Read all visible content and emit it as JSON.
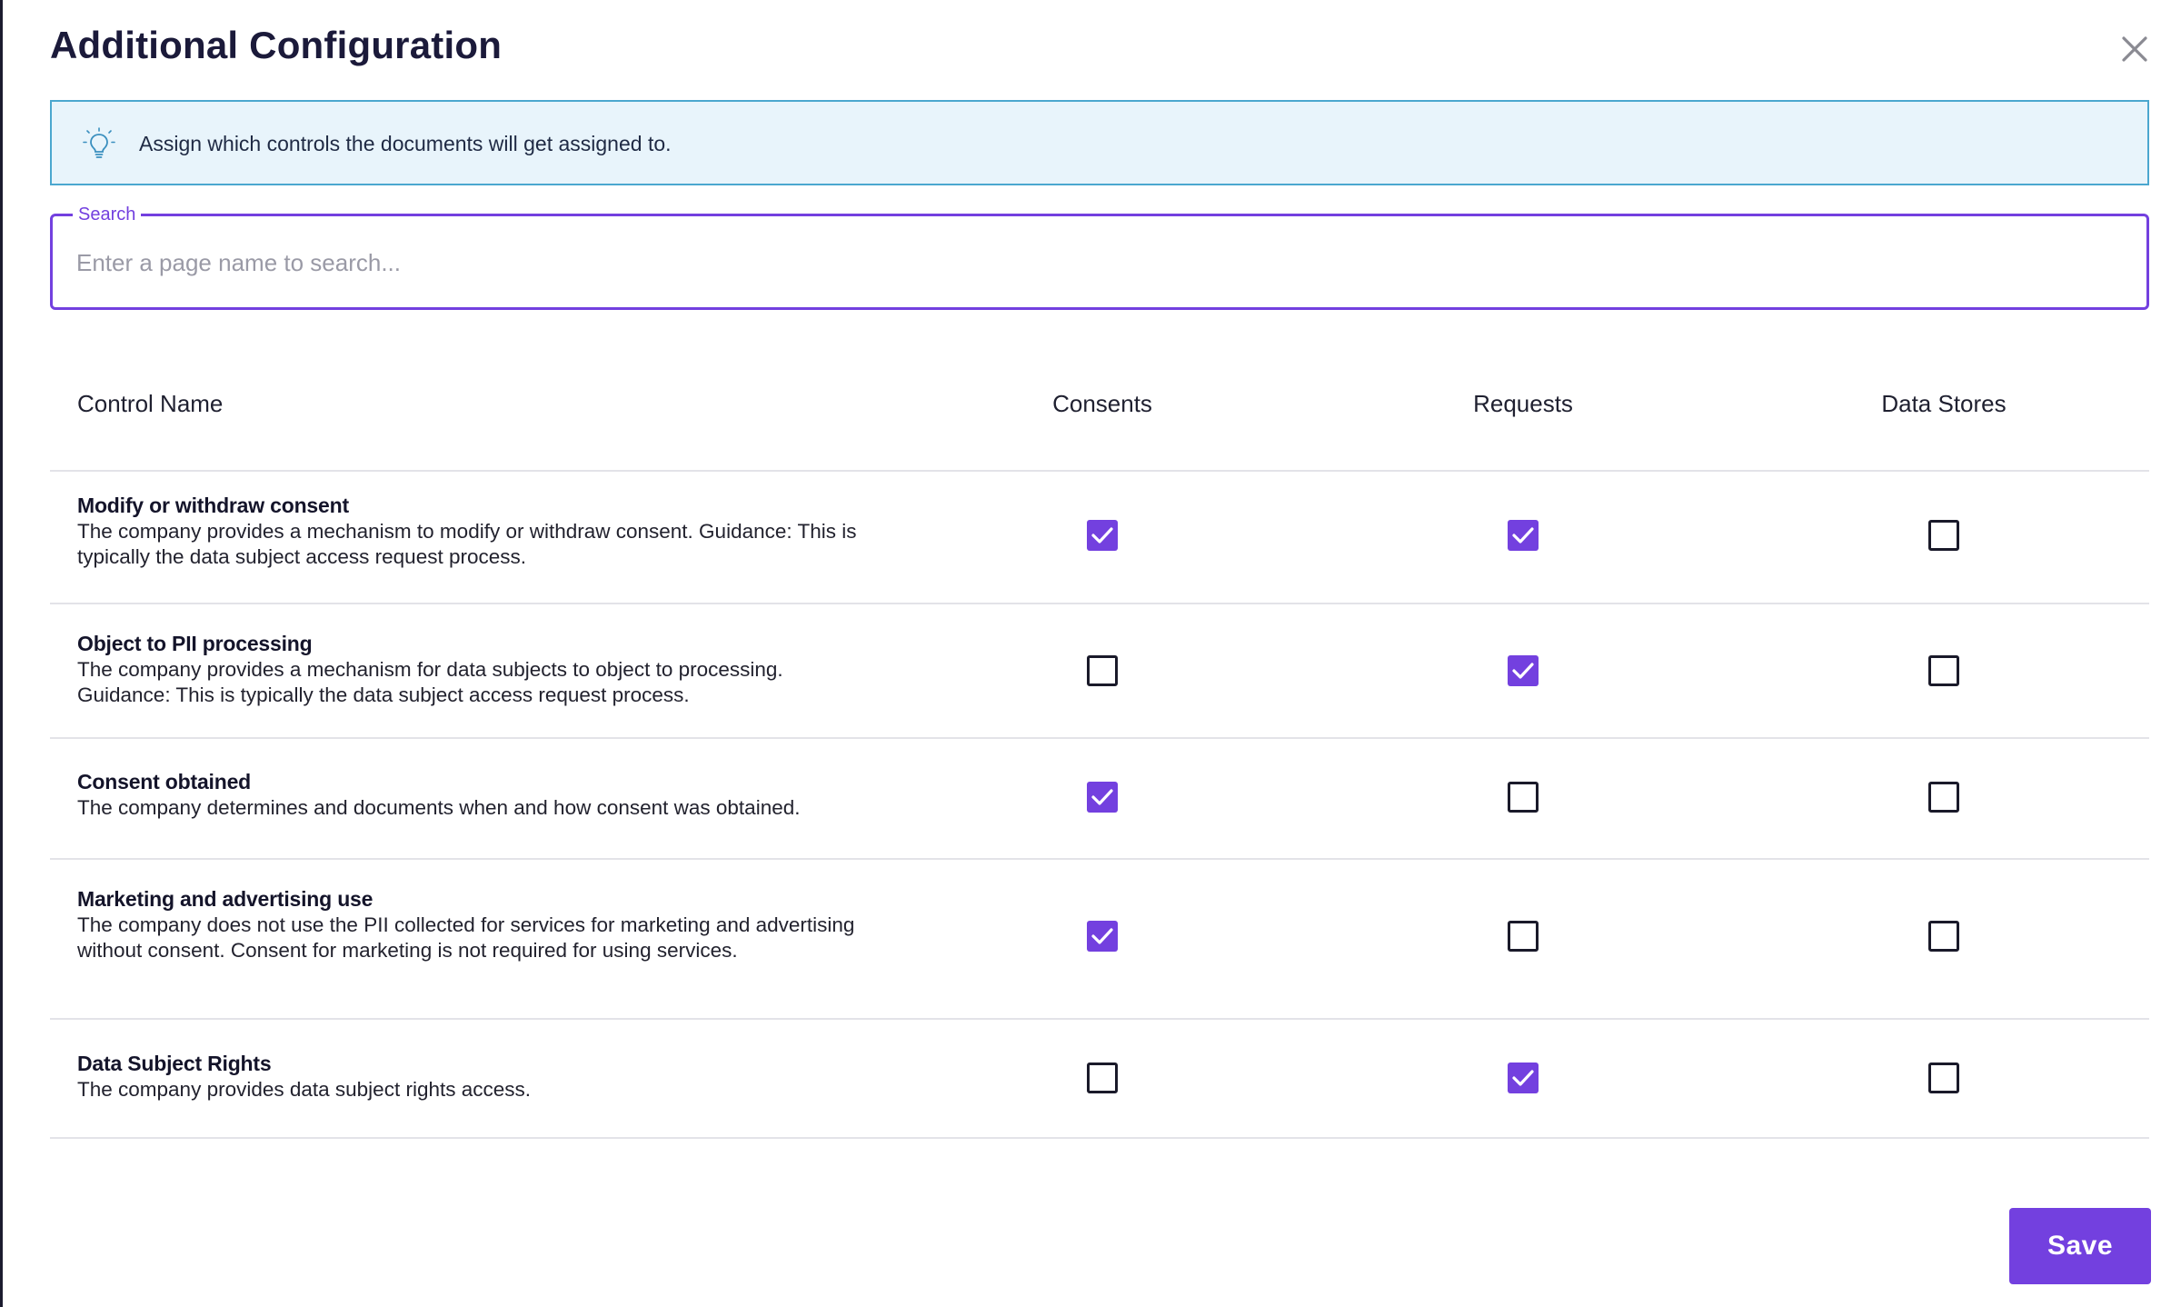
{
  "dialog": {
    "title": "Additional Configuration",
    "close_icon": "close-icon"
  },
  "banner": {
    "icon": "lightbulb-icon",
    "text": "Assign which controls the documents will get assigned to."
  },
  "search": {
    "label": "Search",
    "placeholder": "Enter a page name to search...",
    "value": ""
  },
  "table": {
    "columns": [
      "Control Name",
      "Consents",
      "Requests",
      "Data Stores"
    ],
    "rows": [
      {
        "title": "Modify or withdraw consent",
        "description": "The company provides a mechanism to modify or withdraw consent. Guidance: This is typically the data subject access request process.",
        "consents": true,
        "requests": true,
        "data_stores": false
      },
      {
        "title": "Object to PII processing",
        "description": "The company provides a mechanism for data subjects to object to processing. Guidance: This is typically the data subject access request process.",
        "consents": false,
        "requests": true,
        "data_stores": false
      },
      {
        "title": "Consent obtained",
        "description": "The company determines and documents when and how consent was obtained.",
        "consents": true,
        "requests": false,
        "data_stores": false
      },
      {
        "title": "Marketing and advertising use",
        "description": "The company does not use the PII collected for services for marketing and advertising without consent. Consent for marketing is not required for using services.",
        "consents": true,
        "requests": false,
        "data_stores": false
      },
      {
        "title": "Data Subject Rights",
        "description": "The company provides data subject rights access.",
        "consents": false,
        "requests": true,
        "data_stores": false
      }
    ]
  },
  "footer": {
    "save_label": "Save"
  },
  "colors": {
    "accent": "#7340df",
    "banner_bg": "#e8f4fb",
    "banner_border": "#4ba7cf",
    "title": "#1b1a3a"
  }
}
